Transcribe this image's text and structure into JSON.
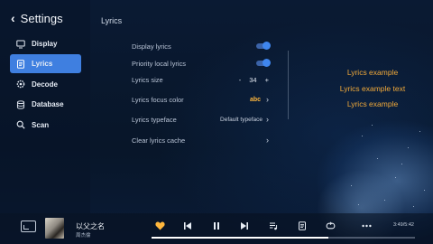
{
  "header": {
    "back_label": "Settings"
  },
  "sidebar": {
    "items": [
      {
        "label": "Display",
        "icon": "monitor-icon",
        "active": false
      },
      {
        "label": "Lyrics",
        "icon": "lyrics-icon",
        "active": true
      },
      {
        "label": "Decode",
        "icon": "decode-icon",
        "active": false
      },
      {
        "label": "Database",
        "icon": "database-icon",
        "active": false
      },
      {
        "label": "Scan",
        "icon": "search-icon",
        "active": false
      }
    ]
  },
  "lyrics": {
    "section_title": "Lyrics",
    "display_lyrics": {
      "label": "Display lyrics",
      "on": true
    },
    "priority_local": {
      "label": "Priority local lyrics",
      "on": true
    },
    "size": {
      "label": "Lyrics size",
      "minus": "-",
      "value": "34",
      "plus": "+"
    },
    "focus_color": {
      "label": "Lyrics focus color",
      "value": "abc"
    },
    "typeface": {
      "label": "Lyrics typeface",
      "value": "Default typeface"
    },
    "clear_cache": {
      "label": "Clear lyrics cache"
    },
    "preview": [
      "Lyrics example",
      "Lyrics example text",
      "Lyrics example"
    ]
  },
  "player": {
    "song": "以父之名",
    "artist": "周杰倫",
    "time": "3:49/5:42",
    "progress": 0.67
  },
  "colors": {
    "accent": "#3f7fe0",
    "lyric_preview": "#f0a93a",
    "heart": "#ffb73d"
  }
}
